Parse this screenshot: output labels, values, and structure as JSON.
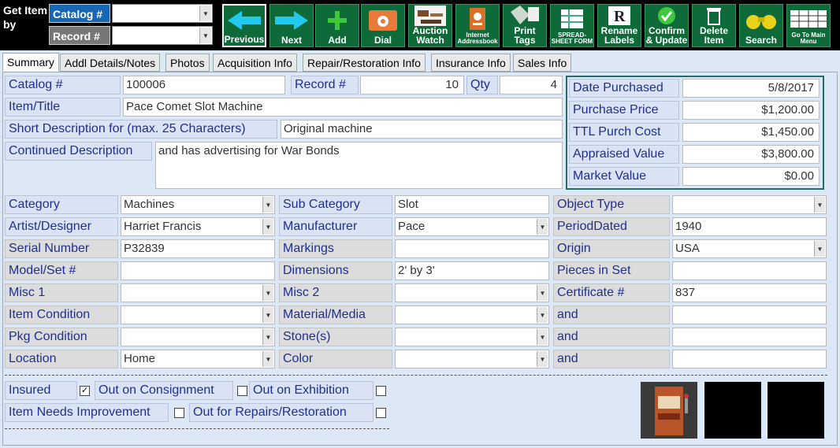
{
  "get_by": {
    "title": "Get Item by",
    "catalog_label": "Catalog #",
    "record_label": "Record #",
    "catalog_value": "",
    "record_value": ""
  },
  "toolbar": [
    {
      "key": "previous",
      "label": "Previous",
      "icon": "left-arrow-icon"
    },
    {
      "key": "next",
      "label": "Next",
      "icon": "right-arrow-icon"
    },
    {
      "key": "add",
      "label": "Add",
      "icon": "plus-icon"
    },
    {
      "key": "dial",
      "label": "Dial",
      "icon": "phone-icon"
    },
    {
      "key": "auction",
      "label": "Auction Watch",
      "icon": "gavel-icon"
    },
    {
      "key": "addressbook",
      "label": "Internet Addressbook",
      "icon": "addressbook-icon"
    },
    {
      "key": "print",
      "label": "Print Tags",
      "icon": "tag-icon"
    },
    {
      "key": "spreadsheet",
      "label": "SPREAD-SHEET FORM",
      "icon": "spreadsheet-icon"
    },
    {
      "key": "rename",
      "label": "Rename Labels",
      "icon": "rename-icon"
    },
    {
      "key": "confirm",
      "label": "Confirm & Update",
      "icon": "check-icon"
    },
    {
      "key": "delete",
      "label": "Delete Item",
      "icon": "trash-icon"
    },
    {
      "key": "search",
      "label": "Search",
      "icon": "binoculars-icon"
    },
    {
      "key": "mainmenu",
      "label": "Go To Main Menu",
      "icon": "grid-icon"
    }
  ],
  "tabs": [
    "Summary",
    "Addl Details/Notes",
    "Photos",
    "Acquisition Info",
    "Repair/Restoration Info",
    "Insurance Info",
    "Sales Info"
  ],
  "summary": {
    "catalog_label": "Catalog #",
    "catalog_value": "100006",
    "record_label": "Record #",
    "record_value": "10",
    "qty_label": "Qty",
    "qty_value": "4",
    "title_label": "Item/Title",
    "title_value": "Pace Comet Slot Machine",
    "short_label": "Short Description for (max. 25 Characters)",
    "short_value": "Original machine",
    "cont_label": "Continued Description",
    "cont_value": "and has advertising for War Bonds"
  },
  "finance": [
    {
      "label": "Date Purchased",
      "value": "5/8/2017"
    },
    {
      "label": "Purchase Price",
      "value": "$1,200.00"
    },
    {
      "label": "TTL Purch Cost",
      "value": "$1,450.00"
    },
    {
      "label": "Appraised Value",
      "value": "$3,800.00"
    },
    {
      "label": "Market Value",
      "value": "$0.00"
    }
  ],
  "details": {
    "category_label": "Category",
    "category_value": "Machines",
    "subcat_label": "Sub Category",
    "subcat_value": "Slot",
    "objtype_label": "Object Type",
    "objtype_value": "",
    "artist_label": "Artist/Designer",
    "artist_value": "Harriet Francis",
    "manuf_label": "Manufacturer",
    "manuf_value": "Pace",
    "period_label": "PeriodDated",
    "period_value": "1940",
    "serial_label": "Serial Number",
    "serial_value": "P32839",
    "markings_label": "Markings",
    "markings_value": "",
    "origin_label": "Origin",
    "origin_value": "USA",
    "model_label": "Model/Set #",
    "model_value": "",
    "dims_label": "Dimensions",
    "dims_value": "2' by 3'",
    "pieces_label": "Pieces in Set",
    "pieces_value": "",
    "misc1_label": "Misc 1",
    "misc1_value": "",
    "misc2_label": "Misc 2",
    "misc2_value": "",
    "cert_label": "Certificate #",
    "cert_value": "837",
    "cond_label": "Item Condition",
    "cond_value": "",
    "material_label": "Material/Media",
    "material_value": "",
    "and1_label": "and",
    "and1_value": "",
    "pkg_label": "Pkg Condition",
    "pkg_value": "",
    "stone_label": "Stone(s)",
    "stone_value": "",
    "and2_label": "and",
    "and2_value": "",
    "location_label": "Location",
    "location_value": "Home",
    "color_label": "Color",
    "color_value": "",
    "and3_label": "and",
    "and3_value": ""
  },
  "flags": {
    "insured": "Insured",
    "consignment": "Out on Consignment",
    "exhibition": "Out on Exhibition",
    "improve": "Item Needs Improvement",
    "repairs": "Out for Repairs/Restoration",
    "check_mark": "✓"
  }
}
